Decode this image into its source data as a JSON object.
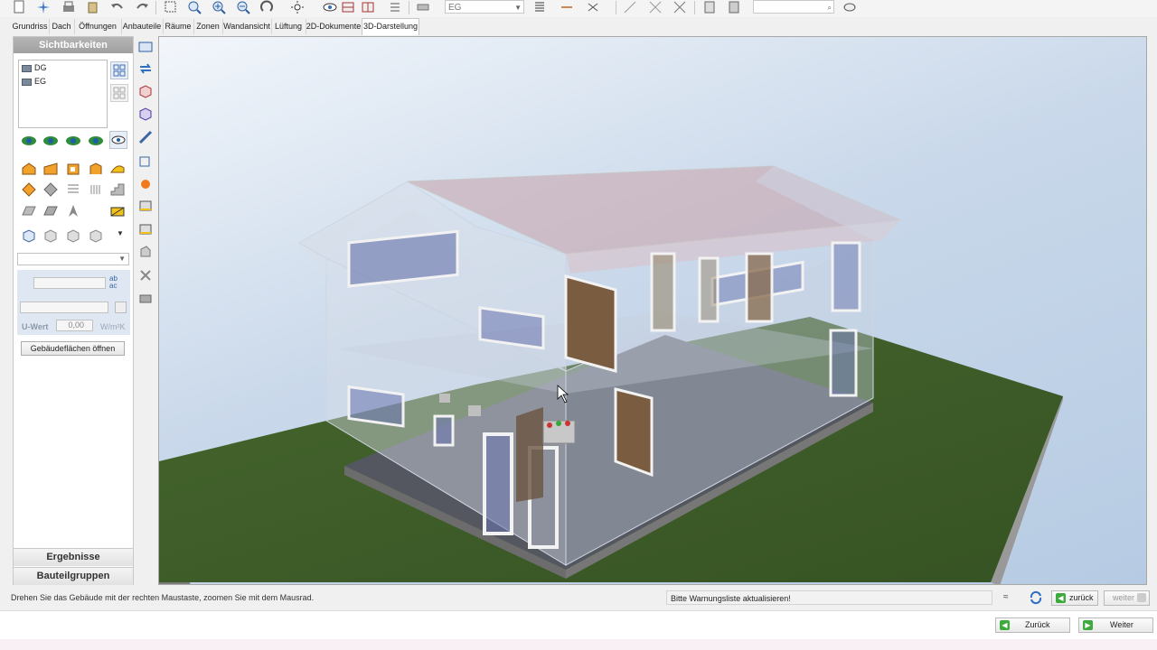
{
  "toolbar": {
    "level_combo": "EG",
    "search_value": ""
  },
  "tabs": [
    {
      "label": "Grundriss"
    },
    {
      "label": "Dach"
    },
    {
      "label": "Öffnungen"
    },
    {
      "label": "Anbauteile"
    },
    {
      "label": "Räume"
    },
    {
      "label": "Zonen"
    },
    {
      "label": "Wandansicht"
    },
    {
      "label": "Lüftung"
    },
    {
      "label": "2D-Dokumente"
    },
    {
      "label": "3D-Darstellung",
      "active": true
    }
  ],
  "left_panel": {
    "header": "Sichtbarkeiten",
    "levels": [
      "DG",
      "EG"
    ],
    "props": {
      "field1": "",
      "uwert_label": "U-Wert",
      "uwert_value": "0,00",
      "uwert_unit": "W/m²K"
    },
    "open_button": "Gebäudeflächen öffnen",
    "footers": [
      "Ergebnisse",
      "Bauteilgruppen"
    ]
  },
  "status": {
    "hint": "Drehen Sie das Gebäude mit der rechten Maustaste, zoomen Sie mit dem Mausrad.",
    "warning": "Bitte Warnungsliste aktualisieren!",
    "back_small": "zurück",
    "next_small": "weiter"
  },
  "bottom": {
    "back": "Zurück",
    "next": "Weiter"
  },
  "colors": {
    "accent_green": "#3cab3c",
    "panel_header": "#a8a8a8",
    "props_bg": "#dfe7f3"
  }
}
